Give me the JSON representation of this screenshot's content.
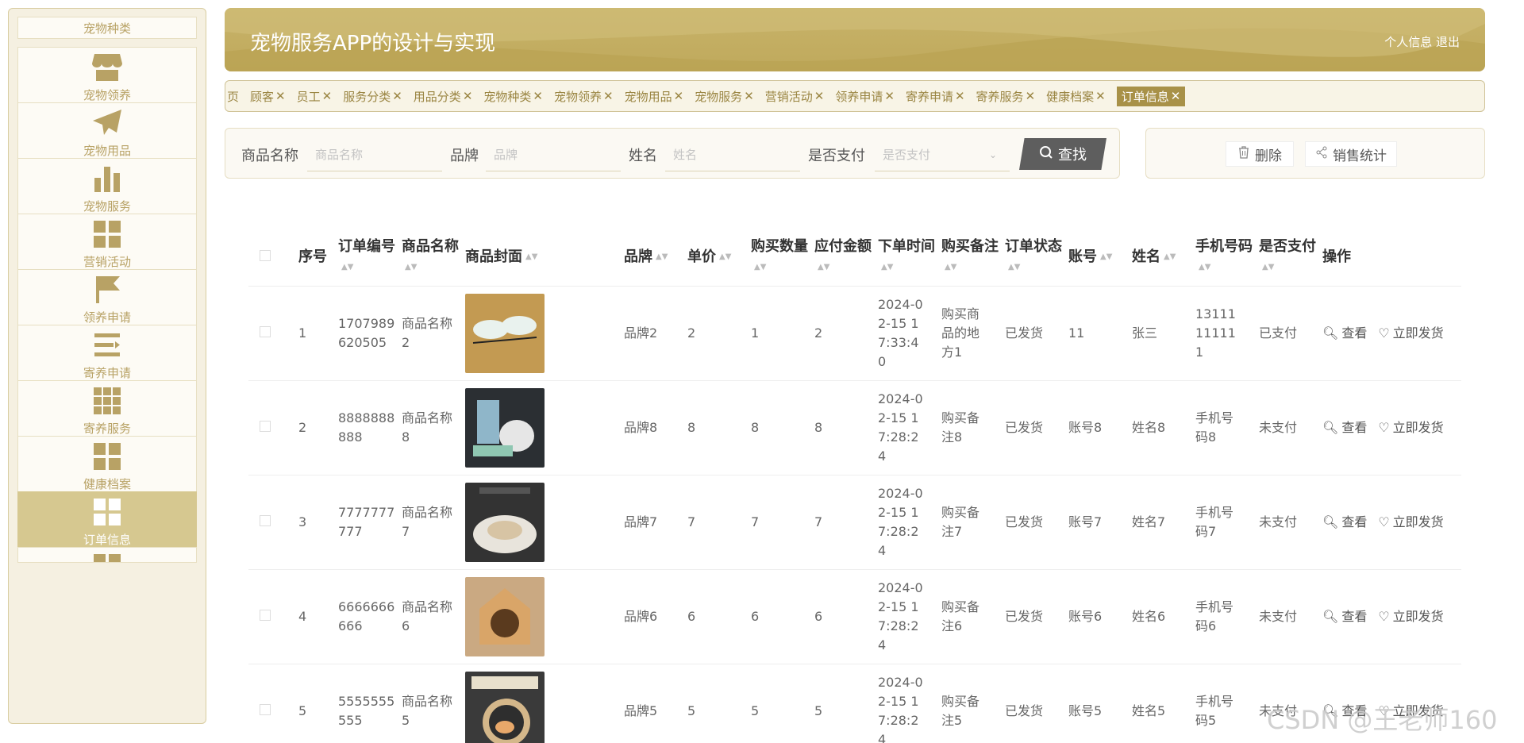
{
  "sidebar": {
    "items": [
      {
        "label": "宠物种类",
        "icon": "none"
      },
      {
        "label": "宠物领养",
        "icon": "store-icon"
      },
      {
        "label": "宠物用品",
        "icon": "paper-plane-icon"
      },
      {
        "label": "宠物服务",
        "icon": "bar-chart-icon"
      },
      {
        "label": "营销活动",
        "icon": "grid-icon"
      },
      {
        "label": "领养申请",
        "icon": "flag-icon"
      },
      {
        "label": "寄养申请",
        "icon": "list-icon"
      },
      {
        "label": "寄养服务",
        "icon": "grid9-icon"
      },
      {
        "label": "健康档案",
        "icon": "grid-icon"
      },
      {
        "label": "订单信息",
        "icon": "grid-icon",
        "active": true
      }
    ]
  },
  "header": {
    "title": "宠物服务APP的设计与实现",
    "user_links": "个人信息 退出"
  },
  "tags": [
    {
      "label": "页",
      "closable": false
    },
    {
      "label": "顾客",
      "closable": true
    },
    {
      "label": "员工",
      "closable": true
    },
    {
      "label": "服务分类",
      "closable": true
    },
    {
      "label": "用品分类",
      "closable": true
    },
    {
      "label": "宠物种类",
      "closable": true
    },
    {
      "label": "宠物领养",
      "closable": true
    },
    {
      "label": "宠物用品",
      "closable": true
    },
    {
      "label": "宠物服务",
      "closable": true
    },
    {
      "label": "营销活动",
      "closable": true
    },
    {
      "label": "领养申请",
      "closable": true
    },
    {
      "label": "寄养申请",
      "closable": true
    },
    {
      "label": "寄养服务",
      "closable": true
    },
    {
      "label": "健康档案",
      "closable": true
    },
    {
      "label": "订单信息",
      "closable": true,
      "active": true
    }
  ],
  "search": {
    "product_name_label": "商品名称",
    "product_name_placeholder": "商品名称",
    "brand_label": "品牌",
    "brand_placeholder": "品牌",
    "name_label": "姓名",
    "name_placeholder": "姓名",
    "paid_label": "是否支付",
    "paid_placeholder": "是否支付",
    "find_button": "查找"
  },
  "actions": {
    "delete_button": "删除",
    "stats_button": "销售统计"
  },
  "table": {
    "headers": [
      "序号",
      "订单编号",
      "商品名称",
      "商品封面",
      "品牌",
      "单价",
      "购买数量",
      "应付金额",
      "下单时间",
      "购买备注",
      "订单状态",
      "账号",
      "姓名",
      "手机号码",
      "是否支付",
      "操作"
    ],
    "rows": [
      {
        "no": "1",
        "order_no": "1707989620505",
        "product": "商品名称2",
        "brand": "品牌2",
        "price": "2",
        "qty": "1",
        "amount": "2",
        "time": "2024-02-15 17:33:40",
        "note": "购买商品的地方1",
        "status": "已发货",
        "account": "11",
        "name": "张三",
        "phone": "13111111111",
        "paid": "已支付"
      },
      {
        "no": "2",
        "order_no": "8888888888",
        "product": "商品名称8",
        "brand": "品牌8",
        "price": "8",
        "qty": "8",
        "amount": "8",
        "time": "2024-02-15 17:28:24",
        "note": "购买备注8",
        "status": "已发货",
        "account": "账号8",
        "name": "姓名8",
        "phone": "手机号码8",
        "paid": "未支付"
      },
      {
        "no": "3",
        "order_no": "7777777777",
        "product": "商品名称7",
        "brand": "品牌7",
        "price": "7",
        "qty": "7",
        "amount": "7",
        "time": "2024-02-15 17:28:24",
        "note": "购买备注7",
        "status": "已发货",
        "account": "账号7",
        "name": "姓名7",
        "phone": "手机号码7",
        "paid": "未支付"
      },
      {
        "no": "4",
        "order_no": "6666666666",
        "product": "商品名称6",
        "brand": "品牌6",
        "price": "6",
        "qty": "6",
        "amount": "6",
        "time": "2024-02-15 17:28:24",
        "note": "购买备注6",
        "status": "已发货",
        "account": "账号6",
        "name": "姓名6",
        "phone": "手机号码6",
        "paid": "未支付"
      },
      {
        "no": "5",
        "order_no": "5555555555",
        "product": "商品名称5",
        "brand": "品牌5",
        "price": "5",
        "qty": "5",
        "amount": "5",
        "time": "2024-02-15 17:28:24",
        "note": "购买备注5",
        "status": "已发货",
        "account": "账号5",
        "name": "姓名5",
        "phone": "手机号码5",
        "paid": "未支付"
      }
    ],
    "ops": {
      "view": "查看",
      "ship": "立即发货"
    }
  },
  "watermark": "CSDN @王老师160",
  "colors": {
    "accent": "#bfa95c",
    "active_tab": "#a89148",
    "sidebar_active": "#d6c890"
  }
}
